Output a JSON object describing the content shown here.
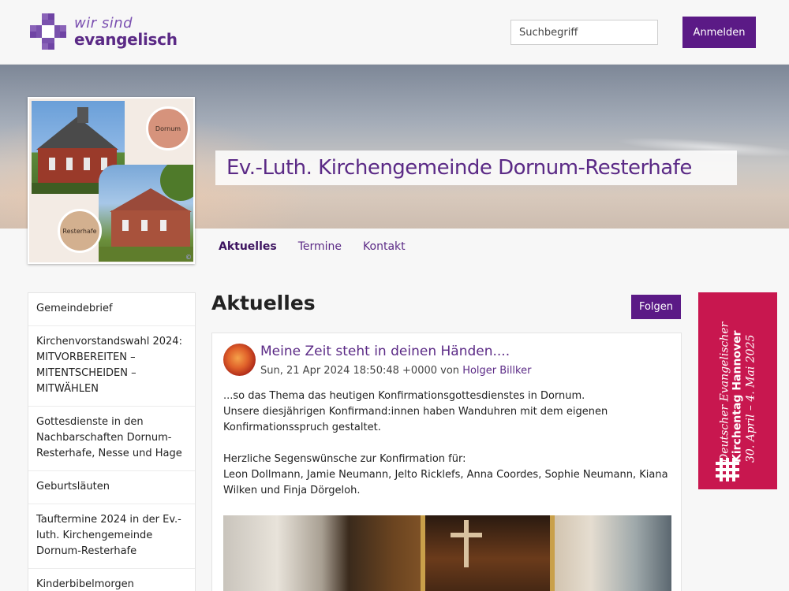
{
  "header": {
    "logo_line1": "wir sind",
    "logo_line2": "evangelisch",
    "search_placeholder": "Suchbegriff",
    "login_label": "Anmelden"
  },
  "hero": {
    "title": "Ev.-Luth. Kirchengemeinde Dornum-Resterhafe",
    "collage_label_1": "Dornum",
    "collage_label_2": "Resterhafe",
    "copyright": "©"
  },
  "tabs": [
    {
      "label": "Aktuelles",
      "active": true
    },
    {
      "label": "Termine",
      "active": false
    },
    {
      "label": "Kontakt",
      "active": false
    }
  ],
  "sidebar": {
    "items": [
      {
        "label": "Gemeindebrief"
      },
      {
        "label": "Kirchenvorstandswahl 2024: MITVORBEREITEN – MITENTSCHEIDEN – MITWÄHLEN"
      },
      {
        "label": "Gottesdienste in den Nachbarschaften Dornum-Resterhafe, Nesse und Hage"
      },
      {
        "label": "Geburtsläuten"
      },
      {
        "label": "Tauftermine 2024 in der Ev.-luth. Kirchengemeinde Dornum-Resterhafe"
      },
      {
        "label": "Kinderbibelmorgen"
      }
    ]
  },
  "main": {
    "title": "Aktuelles",
    "follow_label": "Folgen",
    "post": {
      "title": "Meine Zeit steht in deinen Händen....",
      "date": "Sun, 21 Apr 2024 18:50:48 +0000",
      "by": "von",
      "author": "Holger Billker",
      "line1": "...so das Thema das heutigen Konfirmationsgottesdienstes in Dornum.",
      "line2": "Unsere diesjährigen Konfirmand:innen haben Wanduhren mit dem eigenen Konfirmationsspruch gestaltet.",
      "line3": "Herzliche Segenswünsche zur Konfirmation für:",
      "line4": "Leon Dollmann, Jamie Neumann, Jelto Ricklefs, Anna Coordes, Sophie Neumann, Kiana Wilken und Finja Dörgeloh."
    }
  },
  "banner": {
    "line1": "Deutscher Evangelischer",
    "line2": "Kirchentag Hannover",
    "line3": "30. April – 4. Mai 2025",
    "color": "#c8174f"
  },
  "colors": {
    "brand": "#5b1a86",
    "link": "#5b2a86"
  }
}
